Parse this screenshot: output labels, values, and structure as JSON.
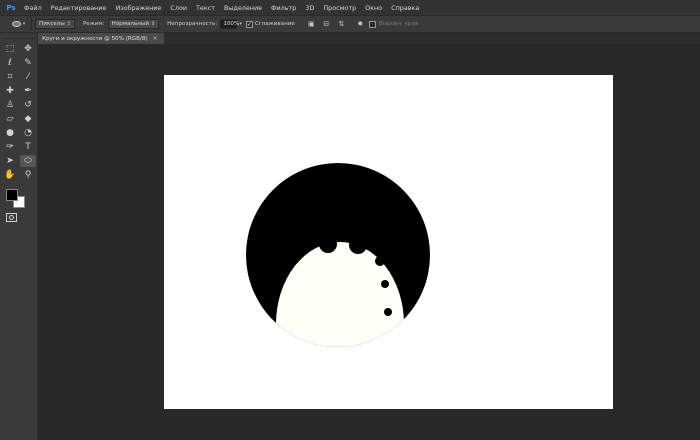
{
  "app": {
    "logo": "Ps"
  },
  "menu": [
    "Файл",
    "Редактирование",
    "Изображение",
    "Слои",
    "Текст",
    "Выделение",
    "Фильтр",
    "3D",
    "Просмотр",
    "Окно",
    "Справка"
  ],
  "options": {
    "tool_icon": "ellipse-tool-icon",
    "mode_label": "Пикселы",
    "blend_label": "Режим:",
    "blend_value": "Нормальный",
    "opacity_label": "Непрозрачность:",
    "opacity_value": "100%",
    "antialias_label": "Сглаживание",
    "align_edges_label": "Выровн. края"
  },
  "document": {
    "tab_title": "Круги и окружности @ 50% (RGB/8)",
    "close_glyph": "×"
  },
  "tools": [
    {
      "name": "rectangular-marquee-icon",
      "glyph": "⬚"
    },
    {
      "name": "move-tool-icon",
      "glyph": "✥"
    },
    {
      "name": "lasso-tool-icon",
      "glyph": "ℓ"
    },
    {
      "name": "quick-selection-icon",
      "glyph": "✎"
    },
    {
      "name": "crop-tool-icon",
      "glyph": "⌗"
    },
    {
      "name": "eyedropper-icon",
      "glyph": "⁄"
    },
    {
      "name": "healing-brush-icon",
      "glyph": "✚"
    },
    {
      "name": "brush-tool-icon",
      "glyph": "✒"
    },
    {
      "name": "clone-stamp-icon",
      "glyph": "♙"
    },
    {
      "name": "history-brush-icon",
      "glyph": "↺"
    },
    {
      "name": "eraser-icon",
      "glyph": "▱"
    },
    {
      "name": "paint-bucket-icon",
      "glyph": "◆"
    },
    {
      "name": "blur-tool-icon",
      "glyph": "●"
    },
    {
      "name": "dodge-tool-icon",
      "glyph": "◔"
    },
    {
      "name": "pen-tool-icon",
      "glyph": "✑"
    },
    {
      "name": "type-tool-icon",
      "glyph": "T"
    },
    {
      "name": "path-selection-icon",
      "glyph": "➤"
    },
    {
      "name": "ellipse-shape-icon",
      "glyph": "⬭",
      "active": true
    },
    {
      "name": "hand-tool-icon",
      "glyph": "✋"
    },
    {
      "name": "zoom-tool-icon",
      "glyph": "⚲"
    }
  ],
  "colors": {
    "foreground": "#000000",
    "background": "#ffffff",
    "canvas_bg": "#ffffff",
    "moon_fill": "#fffff8"
  }
}
